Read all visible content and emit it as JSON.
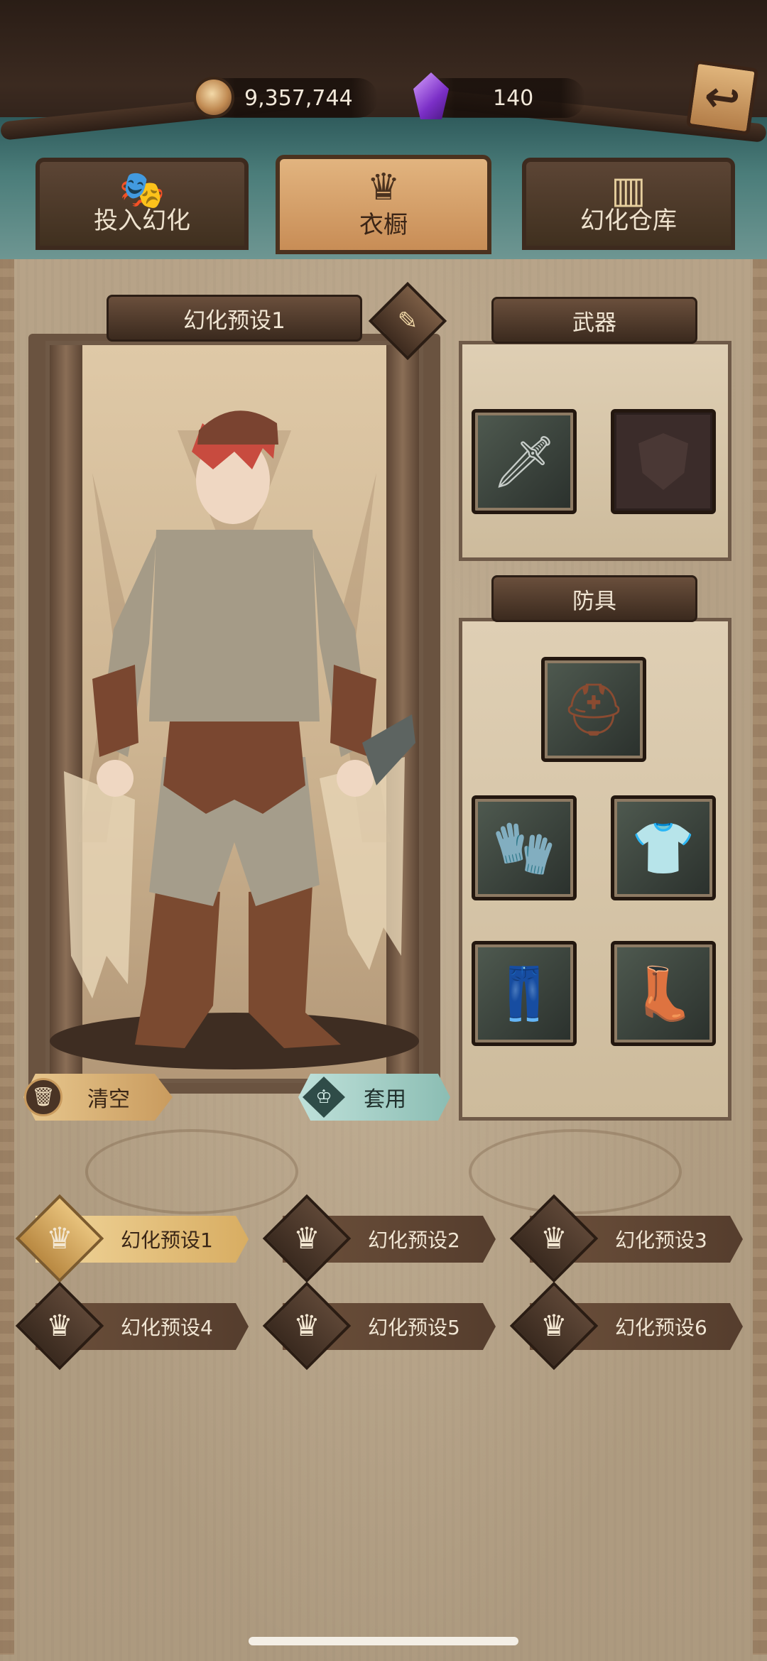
{
  "currency": {
    "coins": "9,357,744",
    "gems": "140"
  },
  "tabs": [
    {
      "label": "投入幻化",
      "icon": "mask-icon"
    },
    {
      "label": "衣橱",
      "icon": "wardrobe-emblem-icon"
    },
    {
      "label": "幻化仓库",
      "icon": "cabinet-icon"
    }
  ],
  "active_tab": "衣橱",
  "preset_panel": {
    "title": "幻化预设1",
    "clear_label": "清空",
    "apply_label": "套用"
  },
  "weapon_section": {
    "title": "武器",
    "slots": [
      {
        "icon": "cleaver-blade-icon",
        "filled": true
      },
      {
        "icon": "shield-placeholder-icon",
        "filled": false
      }
    ]
  },
  "armor_section": {
    "title": "防具",
    "slots": [
      {
        "icon": "leather-cap-icon"
      },
      {
        "icon": "bracer-icon"
      },
      {
        "icon": "linen-shirt-icon"
      },
      {
        "icon": "trousers-icon"
      },
      {
        "icon": "leather-boots-icon"
      }
    ]
  },
  "presets": [
    {
      "label": "幻化预设1",
      "active": true
    },
    {
      "label": "幻化预设2",
      "active": false
    },
    {
      "label": "幻化预设3",
      "active": false
    },
    {
      "label": "幻化预设4",
      "active": false
    },
    {
      "label": "幻化预设5",
      "active": false
    },
    {
      "label": "幻化预设6",
      "active": false
    }
  ],
  "colors": {
    "accent_gold": "#d8ad62",
    "apply_teal": "#8bbdb3",
    "panel_dark": "#553d2d"
  }
}
